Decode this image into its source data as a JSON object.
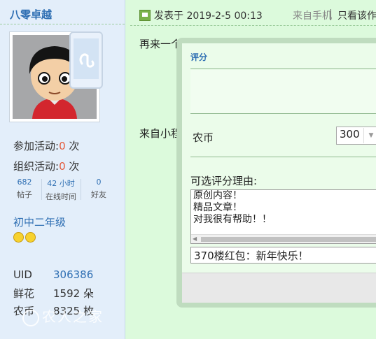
{
  "sidebar": {
    "username": "八零卓越",
    "stats": [
      {
        "label": "参加活动:",
        "num": "0",
        "unit": " 次"
      },
      {
        "label": "组织活动:",
        "num": "0",
        "unit": " 次"
      }
    ],
    "mini_stats": [
      {
        "value": "682",
        "label": "帖子"
      },
      {
        "value": "42 小时",
        "label": "在线时间"
      },
      {
        "value": "0",
        "label": "好友"
      }
    ],
    "grade": "初中二年级",
    "profile": [
      {
        "key": "UID",
        "value": "306386"
      },
      {
        "key": "鲜花",
        "value": "1592 朵"
      },
      {
        "key": "农币",
        "value": "8325 枚"
      }
    ],
    "watermark": "农人之家"
  },
  "post": {
    "posted_at": "发表于 2019-2-5 00:13",
    "from_app": "来自手机",
    "only_view": "只看该作者",
    "body": "再来一个",
    "footer": "来自小程序"
  },
  "dialog": {
    "title": "评分",
    "field_label": "农币",
    "select_value": "300",
    "reason_label": "可选评分理由:",
    "reasons": [
      "原创内容！",
      "精品文章！",
      "对我很有帮助！！"
    ],
    "reason_input": "370楼红包：新年快乐！"
  },
  "colors": {
    "page_bg": "#dcfadc",
    "sidebar_bg": "#e3eefa",
    "link": "#2f6fb3",
    "accent_number": "#e35b3c"
  }
}
